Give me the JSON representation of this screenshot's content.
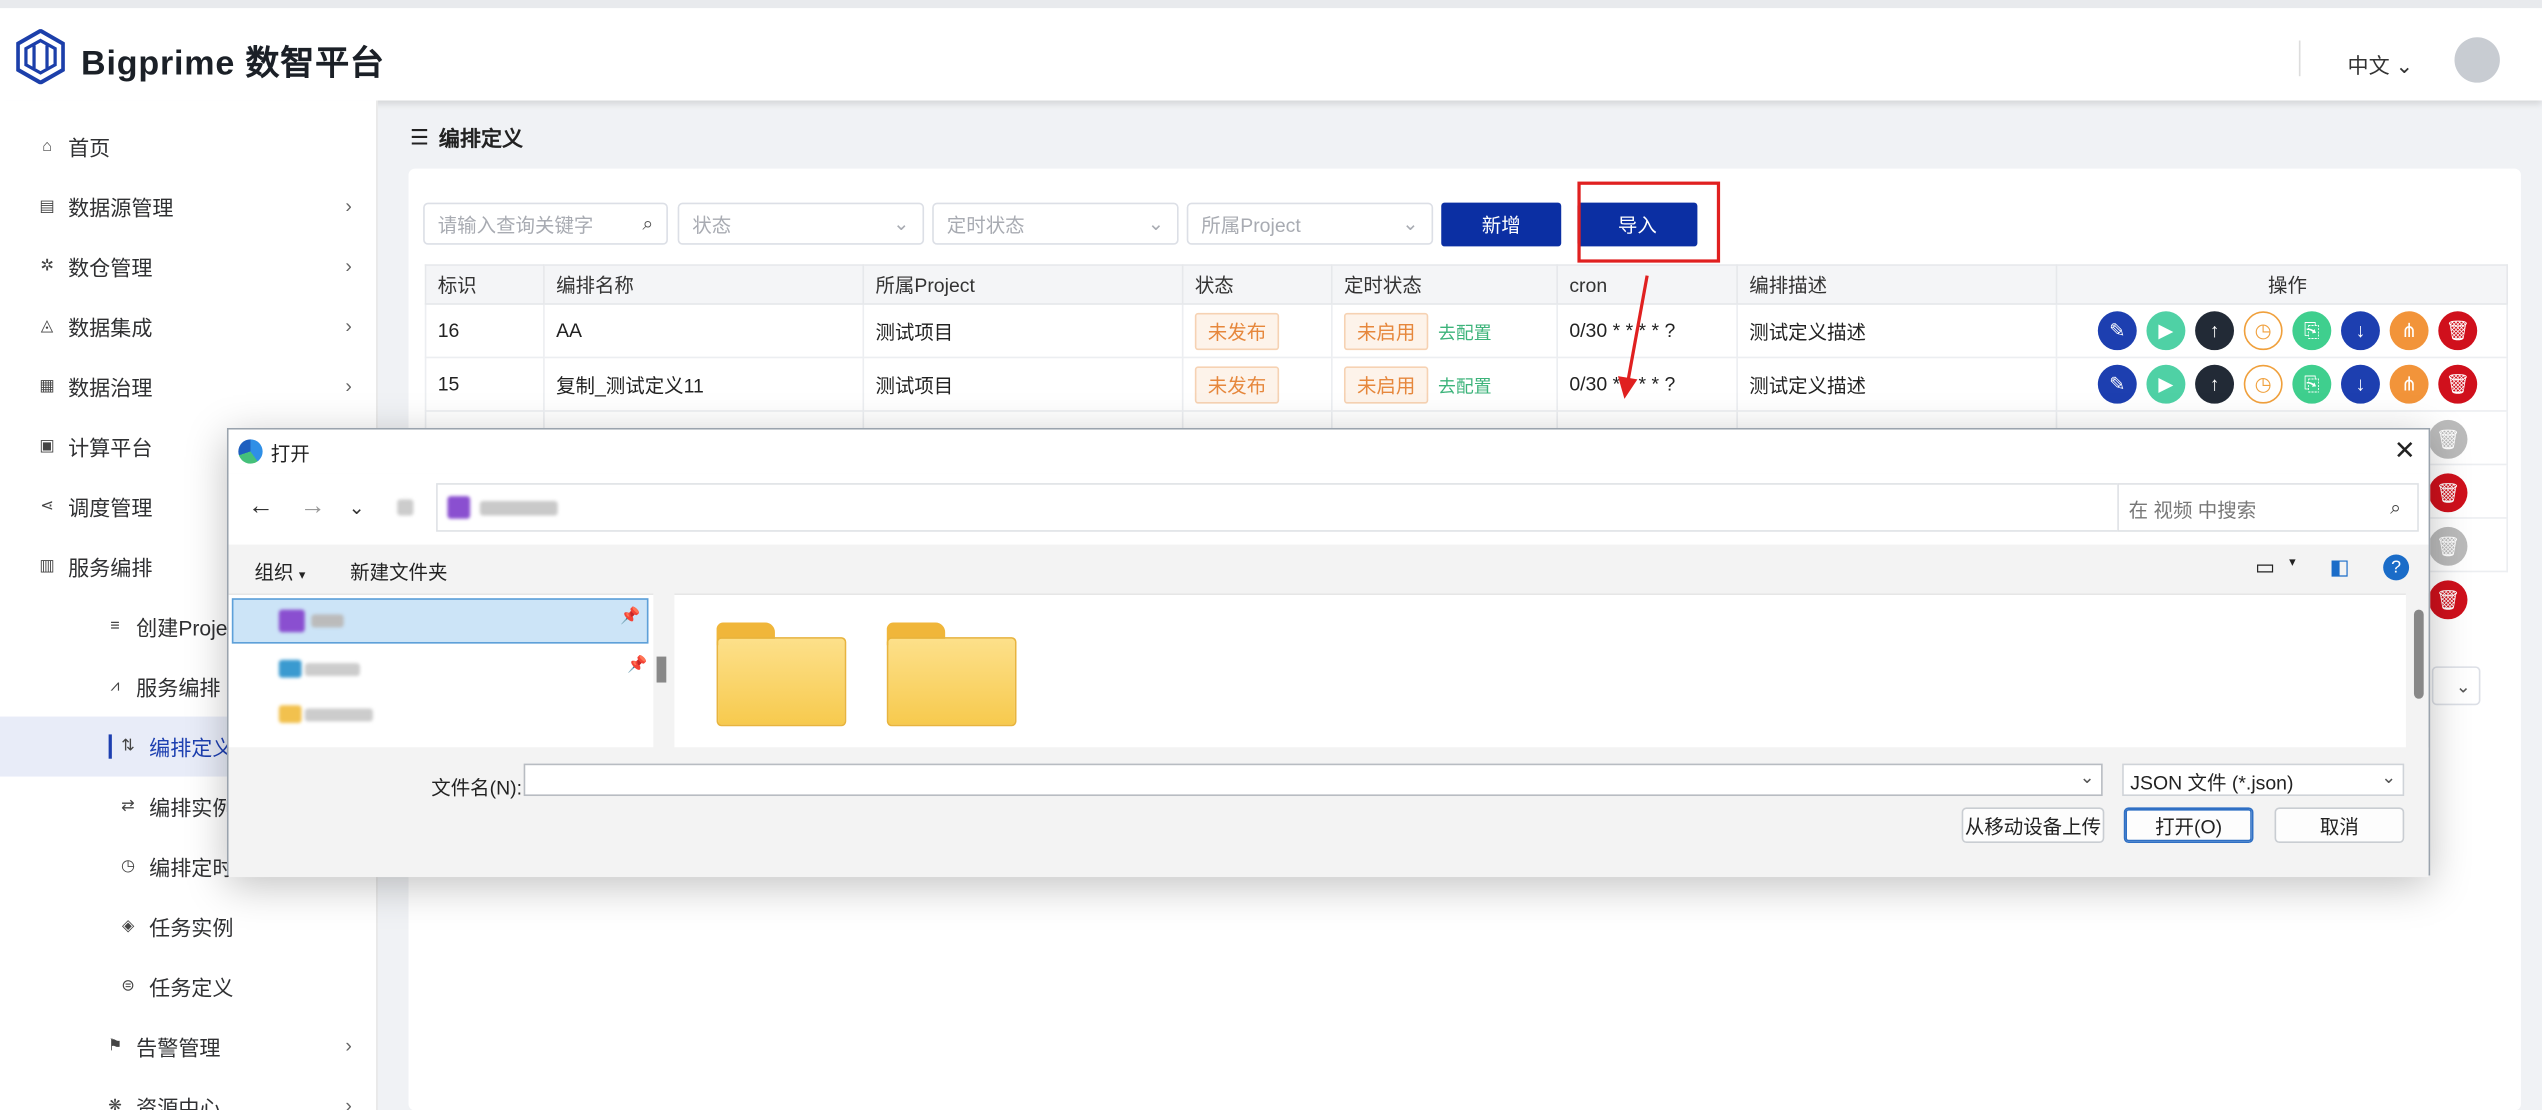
{
  "header": {
    "brand": "Bigprime 数智平台",
    "lang": "中文"
  },
  "sidebar": {
    "items": [
      {
        "label": "首页",
        "icon": "home-icon"
      },
      {
        "label": "数据源管理",
        "icon": "database-icon"
      },
      {
        "label": "数仓管理",
        "icon": "warehouse-icon"
      },
      {
        "label": "数据集成",
        "icon": "integration-icon"
      },
      {
        "label": "数据治理",
        "icon": "governance-icon"
      },
      {
        "label": "计算平台",
        "icon": "compute-icon"
      },
      {
        "label": "调度管理",
        "icon": "schedule-icon"
      },
      {
        "label": "服务编排",
        "icon": "chart-icon"
      },
      {
        "label": "创建Project",
        "icon": "list-icon"
      },
      {
        "label": "服务编排",
        "icon": "line-chart-icon"
      },
      {
        "label": "编排定义",
        "icon": "sort-icon"
      },
      {
        "label": "编排实例",
        "icon": "swap-icon"
      },
      {
        "label": "编排定时",
        "icon": "clock-icon"
      },
      {
        "label": "任务实例",
        "icon": "layers-icon"
      },
      {
        "label": "任务定义",
        "icon": "stamp-icon"
      },
      {
        "label": "告警管理",
        "icon": "flag-icon"
      },
      {
        "label": "资源中心",
        "icon": "resource-icon"
      }
    ]
  },
  "breadcrumb": "编排定义",
  "filters": {
    "search_placeholder": "请输入查询关键字",
    "status_placeholder": "状态",
    "timer_placeholder": "定时状态",
    "project_placeholder": "所属Project",
    "add_label": "新增",
    "import_label": "导入"
  },
  "table": {
    "headers": [
      "标识",
      "编排名称",
      "所属Project",
      "状态",
      "定时状态",
      "cron",
      "编排描述",
      "操作"
    ],
    "rows": [
      {
        "id": "16",
        "name": "AA",
        "project": "测试项目",
        "status": "未发布",
        "timer": "未启用",
        "config": "去配置",
        "cron": "0/30 * * * * ?",
        "desc": "测试定义描述"
      },
      {
        "id": "15",
        "name": "复制_测试定义11",
        "project": "测试项目",
        "status": "未发布",
        "timer": "未启用",
        "config": "去配置",
        "cron": "0/30 * * * * ?",
        "desc": "测试定义描述"
      }
    ]
  },
  "dialog": {
    "title": "打开",
    "search_placeholder": "在 视频 中搜索",
    "organize": "组织",
    "new_folder": "新建文件夹",
    "filename_label": "文件名(N):",
    "filetype": "JSON 文件 (*.json)",
    "upload_mobile": "从移动设备上传",
    "open": "打开(O)",
    "cancel": "取消"
  }
}
